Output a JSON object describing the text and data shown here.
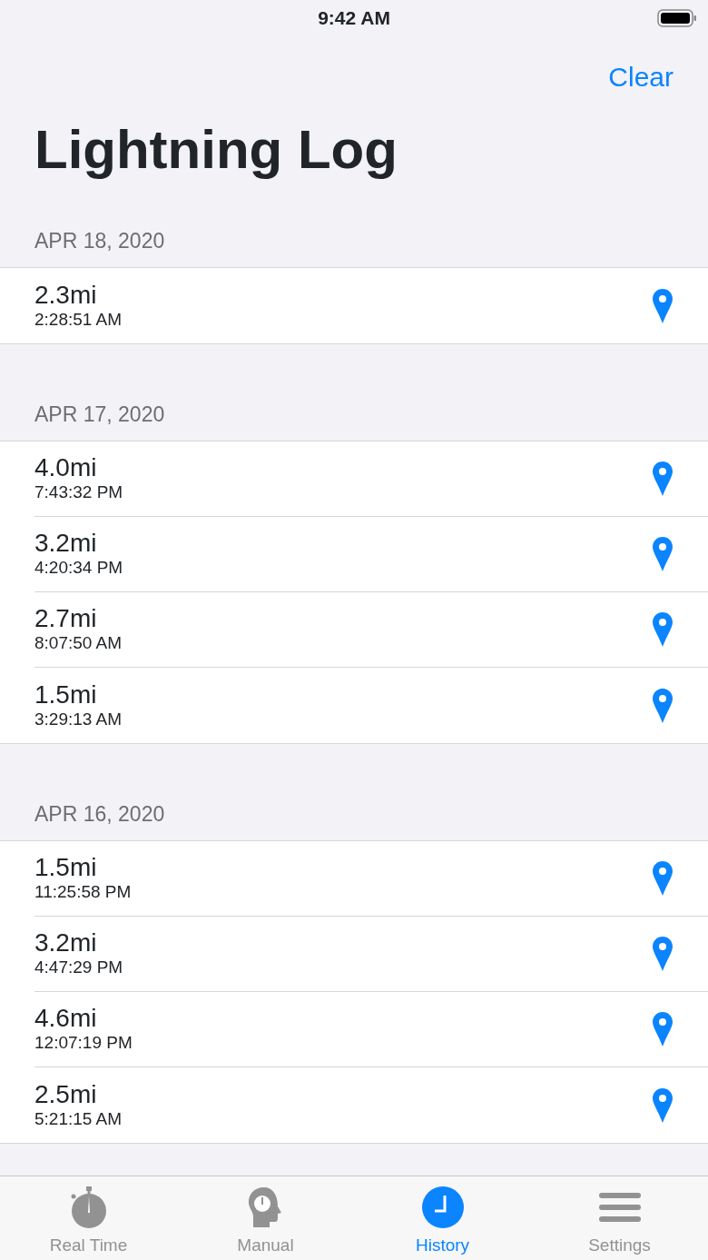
{
  "status_bar": {
    "time": "9:42 AM"
  },
  "nav": {
    "action": "Clear",
    "title": "Lightning Log"
  },
  "sections": [
    {
      "header": "APR 18, 2020",
      "rows": [
        {
          "distance": "2.3mi",
          "time": "2:28:51 AM"
        }
      ]
    },
    {
      "header": "APR 17, 2020",
      "rows": [
        {
          "distance": "4.0mi",
          "time": "7:43:32 PM"
        },
        {
          "distance": "3.2mi",
          "time": "4:20:34 PM"
        },
        {
          "distance": "2.7mi",
          "time": "8:07:50 AM"
        },
        {
          "distance": "1.5mi",
          "time": "3:29:13 AM"
        }
      ]
    },
    {
      "header": "APR 16, 2020",
      "rows": [
        {
          "distance": "1.5mi",
          "time": "11:25:58 PM"
        },
        {
          "distance": "3.2mi",
          "time": "4:47:29 PM"
        },
        {
          "distance": "4.6mi",
          "time": "12:07:19 PM"
        },
        {
          "distance": "2.5mi",
          "time": "5:21:15 AM"
        }
      ]
    }
  ],
  "tabs": [
    {
      "label": "Real Time",
      "kind": "stopwatch",
      "selected": false
    },
    {
      "label": "Manual",
      "kind": "head",
      "selected": false
    },
    {
      "label": "History",
      "kind": "clock",
      "selected": true
    },
    {
      "label": "Settings",
      "kind": "menu",
      "selected": false
    }
  ]
}
